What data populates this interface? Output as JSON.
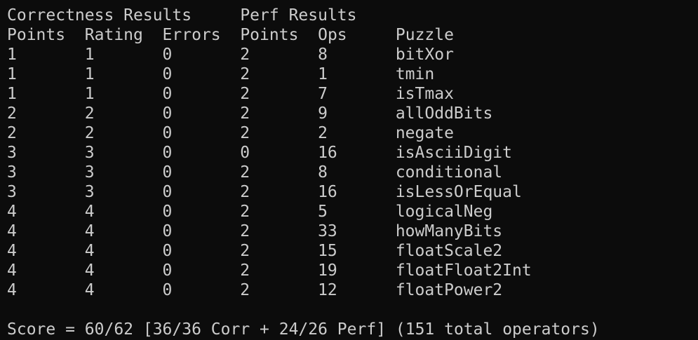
{
  "header": {
    "line1": "Correctness Results     Perf Results",
    "line2": "Points  Rating  Errors  Points  Ops     Puzzle"
  },
  "rows": [
    {
      "points": "1",
      "rating": "1",
      "errors": "0",
      "perf_points": "2",
      "ops": "8",
      "puzzle": "bitXor"
    },
    {
      "points": "1",
      "rating": "1",
      "errors": "0",
      "perf_points": "2",
      "ops": "1",
      "puzzle": "tmin"
    },
    {
      "points": "1",
      "rating": "1",
      "errors": "0",
      "perf_points": "2",
      "ops": "7",
      "puzzle": "isTmax"
    },
    {
      "points": "2",
      "rating": "2",
      "errors": "0",
      "perf_points": "2",
      "ops": "9",
      "puzzle": "allOddBits"
    },
    {
      "points": "2",
      "rating": "2",
      "errors": "0",
      "perf_points": "2",
      "ops": "2",
      "puzzle": "negate"
    },
    {
      "points": "3",
      "rating": "3",
      "errors": "0",
      "perf_points": "0",
      "ops": "16",
      "puzzle": "isAsciiDigit"
    },
    {
      "points": "3",
      "rating": "3",
      "errors": "0",
      "perf_points": "2",
      "ops": "8",
      "puzzle": "conditional"
    },
    {
      "points": "3",
      "rating": "3",
      "errors": "0",
      "perf_points": "2",
      "ops": "16",
      "puzzle": "isLessOrEqual"
    },
    {
      "points": "4",
      "rating": "4",
      "errors": "0",
      "perf_points": "2",
      "ops": "5",
      "puzzle": "logicalNeg"
    },
    {
      "points": "4",
      "rating": "4",
      "errors": "0",
      "perf_points": "2",
      "ops": "33",
      "puzzle": "howManyBits"
    },
    {
      "points": "4",
      "rating": "4",
      "errors": "0",
      "perf_points": "2",
      "ops": "15",
      "puzzle": "floatScale2"
    },
    {
      "points": "4",
      "rating": "4",
      "errors": "0",
      "perf_points": "2",
      "ops": "19",
      "puzzle": "floatFloat2Int"
    },
    {
      "points": "4",
      "rating": "4",
      "errors": "0",
      "perf_points": "2",
      "ops": "12",
      "puzzle": "floatPower2"
    }
  ],
  "score": "Score = 60/62 [36/36 Corr + 24/26 Perf] (151 total operators)",
  "colors": {
    "background": "#0c0c0c",
    "text": "#cccccc"
  }
}
